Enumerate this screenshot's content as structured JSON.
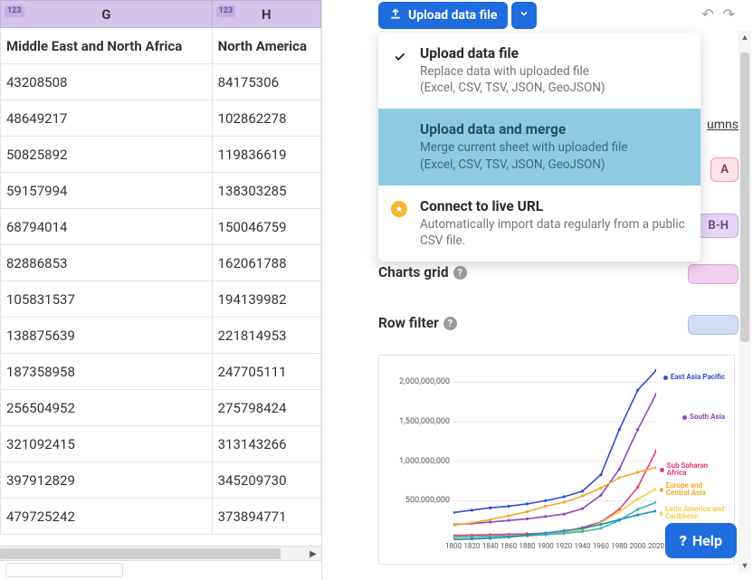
{
  "sheet": {
    "col_badge": "123",
    "columns": [
      "G",
      "H"
    ],
    "header_row": [
      "Middle East and North Africa",
      "North America"
    ],
    "rows": [
      [
        "43208508",
        "84175306"
      ],
      [
        "48649217",
        "102862278"
      ],
      [
        "50825892",
        "119836619"
      ],
      [
        "59157994",
        "138303285"
      ],
      [
        "68794014",
        "150046759"
      ],
      [
        "82886853",
        "162061788"
      ],
      [
        "105831537",
        "194139982"
      ],
      [
        "138875639",
        "221814953"
      ],
      [
        "187358958",
        "247705111"
      ],
      [
        "256504952",
        "275798424"
      ],
      [
        "321092415",
        "313143266"
      ],
      [
        "397912829",
        "345209730"
      ],
      [
        "479725242",
        "373894771"
      ]
    ]
  },
  "upload_button_label": "Upload data file",
  "dropdown": {
    "items": [
      {
        "title": "Upload data file",
        "desc1": "Replace data with uploaded file",
        "desc2": "(Excel, CSV, TSV, JSON, GeoJSON)"
      },
      {
        "title": "Upload data and merge",
        "desc1": "Merge current sheet with uploaded file",
        "desc2": "(Excel, CSV, TSV, JSON, GeoJSON)"
      },
      {
        "title": "Connect to live URL",
        "desc1": "Automatically import data regularly from a public CSV file.",
        "desc2": ""
      }
    ]
  },
  "rhs": {
    "umns_text": "umns",
    "pill_a": "A",
    "pill_bh": "B-H",
    "charts_label": "Charts grid",
    "rowfilter_label": "Row filter",
    "help_label": "Help"
  },
  "chart_data": {
    "type": "line",
    "xlabel": "",
    "ylabel": "",
    "x": [
      1800,
      1820,
      1840,
      1860,
      1880,
      1900,
      1920,
      1940,
      1960,
      1980,
      2000,
      2020
    ],
    "y_ticks": [
      500000000,
      1000000000,
      1500000000,
      2000000000
    ],
    "y_tick_labels": [
      "500,000,000",
      "1,000,000,000",
      "1,500,000,000",
      "2,000,000,000"
    ],
    "ylim": [
      0,
      2200000000
    ],
    "series": [
      {
        "name": "East Asia Pacific",
        "color": "#2d4fd1",
        "values": [
          350000000,
          380000000,
          410000000,
          430000000,
          460000000,
          500000000,
          550000000,
          620000000,
          830000000,
          1400000000,
          1900000000,
          2150000000
        ]
      },
      {
        "name": "South Asia",
        "color": "#8b48c4",
        "values": [
          200000000,
          210000000,
          230000000,
          250000000,
          270000000,
          300000000,
          330000000,
          400000000,
          570000000,
          900000000,
          1400000000,
          1850000000
        ]
      },
      {
        "name": "Sub Saharan Africa",
        "color": "#e33f6e",
        "values": [
          60000000,
          65000000,
          70000000,
          75000000,
          80000000,
          90000000,
          110000000,
          160000000,
          230000000,
          390000000,
          670000000,
          1130000000
        ]
      },
      {
        "name": "Europe and Central Asia",
        "color": "#f3a72a",
        "values": [
          190000000,
          220000000,
          260000000,
          310000000,
          360000000,
          430000000,
          480000000,
          560000000,
          660000000,
          790000000,
          860000000,
          920000000
        ]
      },
      {
        "name": "Latin America and Caribbean",
        "color": "#f2d14a",
        "values": [
          20000000,
          24000000,
          30000000,
          38000000,
          50000000,
          70000000,
          95000000,
          130000000,
          220000000,
          360000000,
          520000000,
          650000000
        ]
      },
      {
        "name": "Middle East and North Africa",
        "color": "#3bb6b0",
        "values": [
          40000000,
          45000000,
          50000000,
          55000000,
          60000000,
          70000000,
          85000000,
          110000000,
          150000000,
          250000000,
          390000000,
          480000000
        ]
      },
      {
        "name": "North America",
        "color": "#1e90c7",
        "values": [
          8000000,
          15000000,
          25000000,
          40000000,
          65000000,
          90000000,
          120000000,
          150000000,
          200000000,
          260000000,
          320000000,
          370000000
        ]
      }
    ],
    "legend_visible": [
      "East Asia Pacific",
      "South Asia",
      "Sub Saharan Africa",
      "Europe and Central Asia",
      "Latin America and Caribbean"
    ]
  }
}
